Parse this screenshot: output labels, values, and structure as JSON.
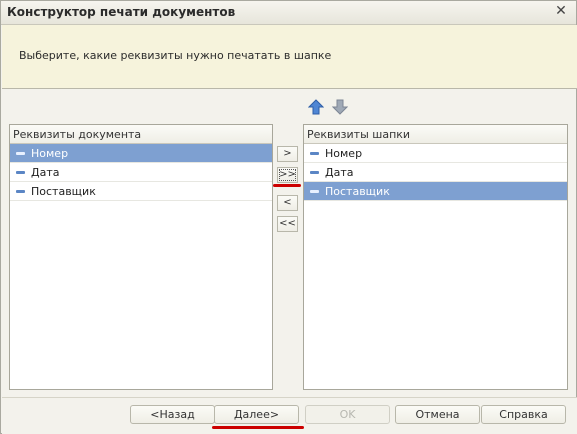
{
  "window": {
    "title": "Конструктор печати документов",
    "close_icon": "close-icon"
  },
  "header": {
    "instruction": "Выберите, какие реквизиты нужно печатать в шапке"
  },
  "reorder": {
    "up_icon": "arrow-up-icon",
    "down_icon": "arrow-down-icon"
  },
  "left_list": {
    "title": "Реквизиты документа",
    "items": [
      {
        "label": "Номер",
        "selected": true
      },
      {
        "label": "Дата",
        "selected": false
      },
      {
        "label": "Поставщик",
        "selected": false
      }
    ]
  },
  "right_list": {
    "title": "Реквизиты шапки",
    "items": [
      {
        "label": "Номер",
        "selected": false
      },
      {
        "label": "Дата",
        "selected": false
      },
      {
        "label": "Поставщик",
        "selected": true
      }
    ]
  },
  "move_buttons": {
    "add": ">",
    "add_all": ">>",
    "remove": "<",
    "remove_all": "<<"
  },
  "footer": {
    "back": "<Назад",
    "next": "Далее>",
    "ok": "OK",
    "cancel": "Отмена",
    "help": "Справка"
  },
  "colors": {
    "selection": "#7ea0d1",
    "header_panel": "#f6f3dc",
    "highlight_mark": "#cc0000"
  }
}
